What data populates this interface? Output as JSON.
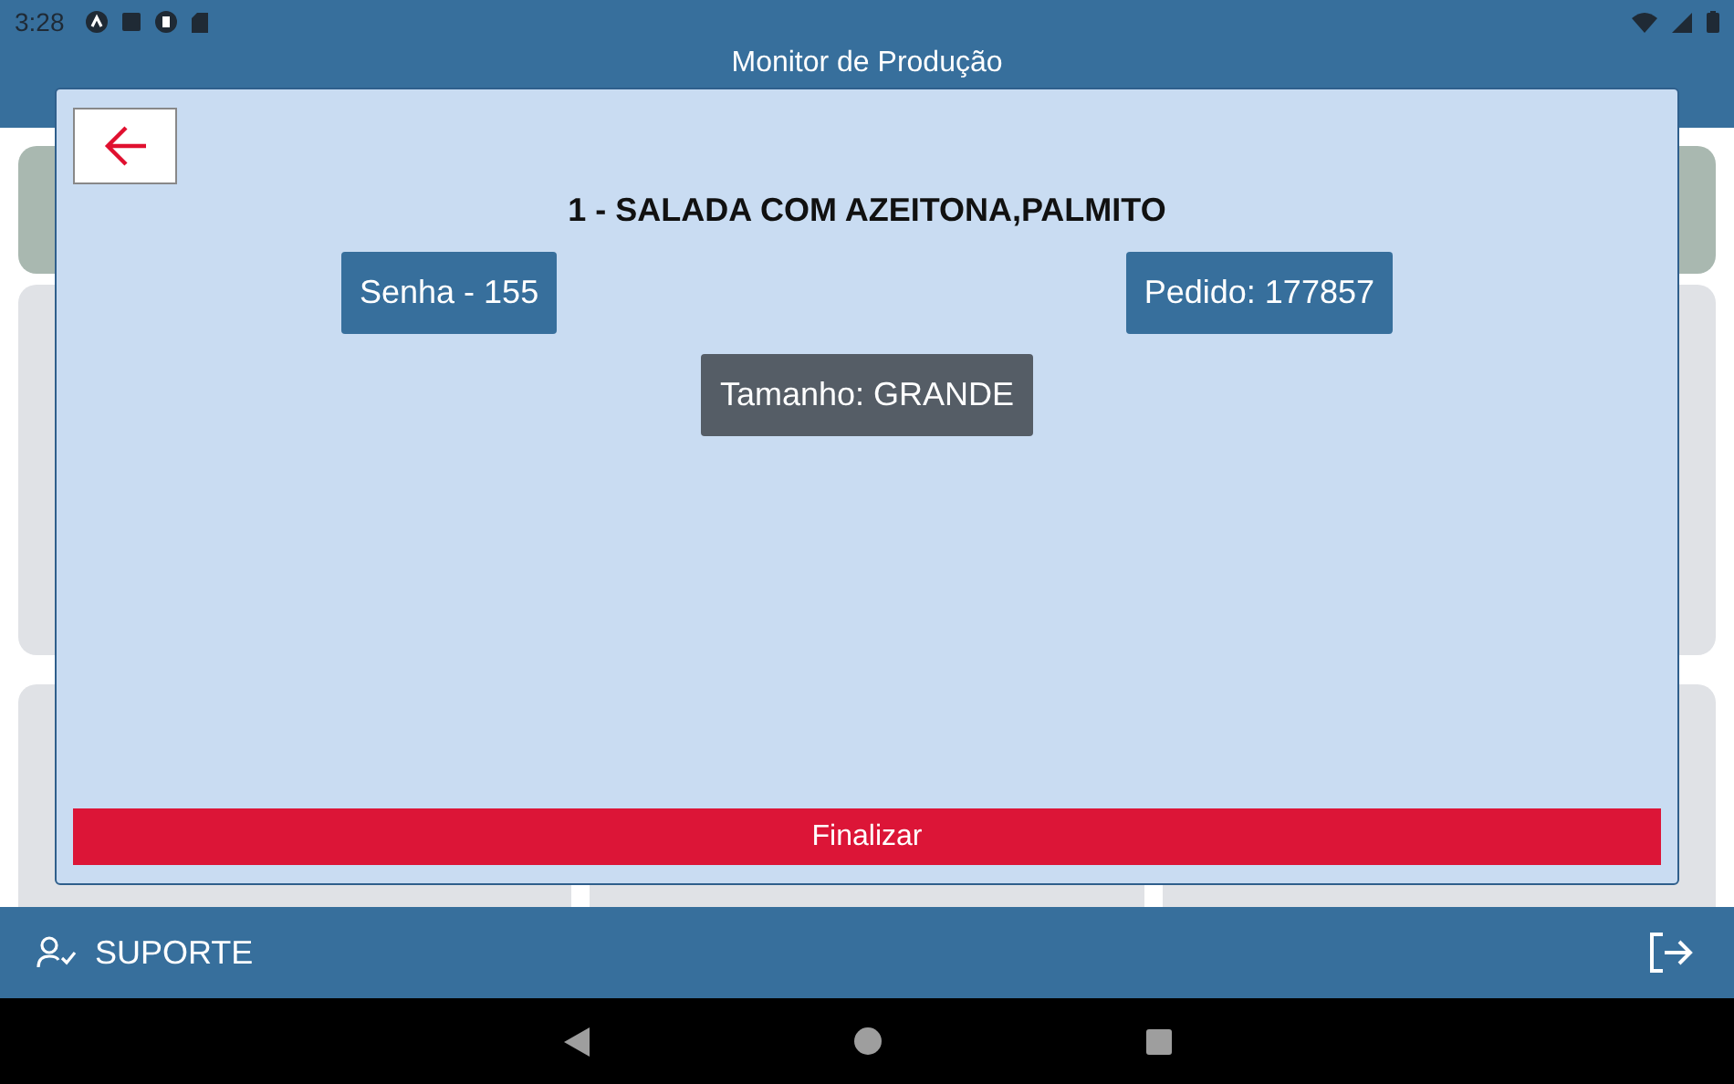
{
  "status_bar": {
    "time": "3:28"
  },
  "header": {
    "title": "Monitor de Produção"
  },
  "dialog": {
    "title": "1 - SALADA COM AZEITONA,PALMITO",
    "tags": [
      {
        "kind": "primary",
        "label": "Senha - 155"
      },
      {
        "kind": "primary",
        "label": "Pedido: 177857"
      },
      {
        "kind": "secondary",
        "label": "Tamanho: GRANDE"
      }
    ],
    "action": "Finalizar"
  },
  "footer": {
    "support": "SUPORTE"
  }
}
